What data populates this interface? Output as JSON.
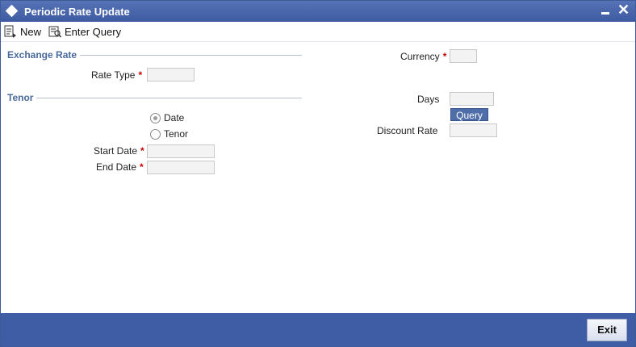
{
  "window": {
    "title": "Periodic Rate Update"
  },
  "toolbar": {
    "new_label": "New",
    "enter_query_label": "Enter Query"
  },
  "sections": {
    "exchange_rate": "Exchange Rate",
    "tenor": "Tenor"
  },
  "fields": {
    "rate_type": {
      "label": "Rate Type",
      "required": "*",
      "value": ""
    },
    "start_date": {
      "label": "Start Date",
      "required": "*",
      "value": ""
    },
    "end_date": {
      "label": "End Date",
      "required": "*",
      "value": ""
    },
    "currency": {
      "label": "Currency",
      "required": "*",
      "value": ""
    },
    "days": {
      "label": "Days",
      "value": ""
    },
    "discount_rate": {
      "label": "Discount Rate",
      "value": ""
    }
  },
  "radios": {
    "date": {
      "label": "Date",
      "checked": true
    },
    "tenor": {
      "label": "Tenor",
      "checked": false
    }
  },
  "buttons": {
    "query": "Query",
    "exit": "Exit"
  }
}
